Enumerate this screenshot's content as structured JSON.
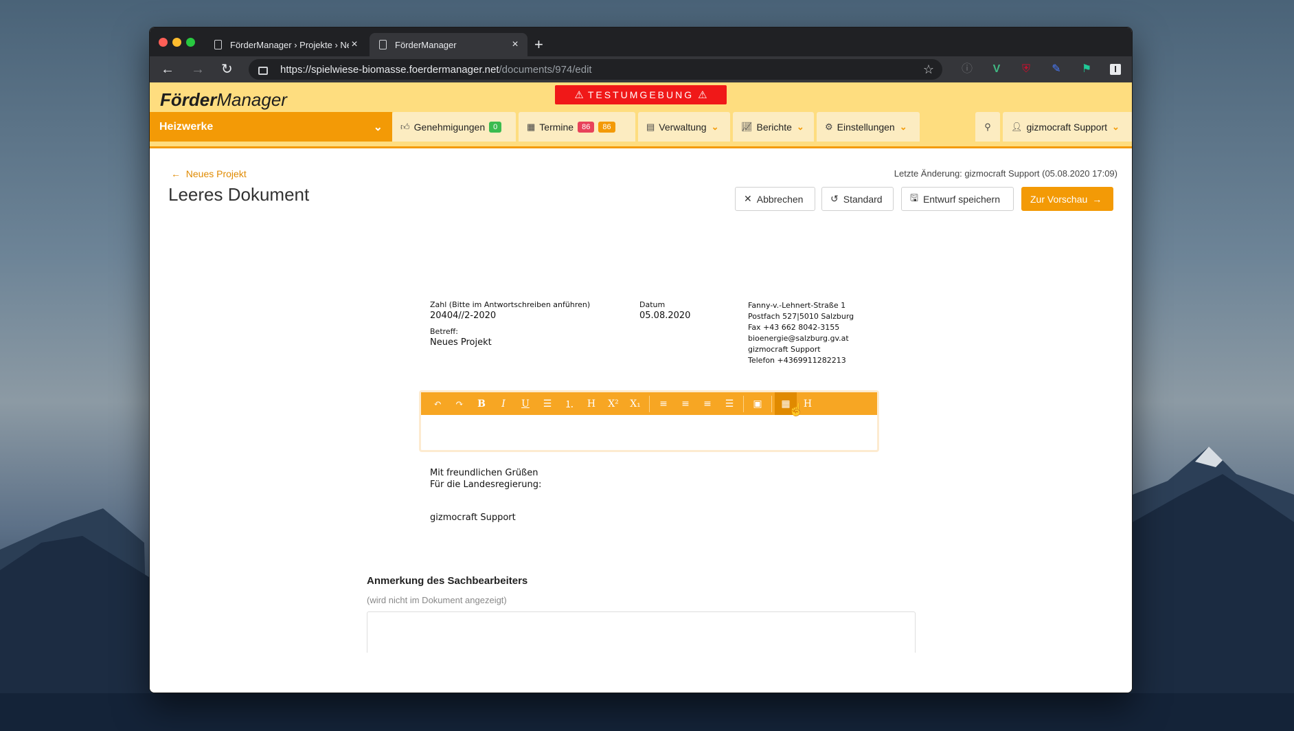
{
  "browser": {
    "tabs": [
      {
        "title": "FörderManager › Projekte › Ne",
        "active": false
      },
      {
        "title": "FörderManager",
        "active": true
      }
    ],
    "url_host": "https://spielwiese-biomasse.foerdermanager.net",
    "url_path": "/documents/974/edit"
  },
  "header": {
    "logo_bold": "Förder",
    "logo_rest": "Manager",
    "test_banner": "TESTUMGEBUNG",
    "site": "Heizwerke",
    "nav": {
      "approvals": {
        "label": "Genehmigungen",
        "badge": "0"
      },
      "appointments": {
        "label": "Termine",
        "badge_red": "86",
        "badge_orange": "86"
      },
      "admin": {
        "label": "Verwaltung"
      },
      "reports": {
        "label": "Berichte"
      },
      "settings": {
        "label": "Einstellungen"
      },
      "user": {
        "label": "gizmocraft Support"
      }
    }
  },
  "page": {
    "back_link": "Neues Projekt",
    "title": "Leeres Dokument",
    "last_change": "Letzte Änderung: gizmocraft Support (05.08.2020 17:09)",
    "buttons": {
      "cancel": "Abbrechen",
      "default": "Standard",
      "save_draft": "Entwurf speichern",
      "preview": "Zur Vorschau"
    }
  },
  "letter": {
    "zahl_label": "Zahl (Bitte im Antwortschreiben anführen)",
    "zahl_value": "20404//2-2020",
    "betreff_label": "Betreff:",
    "betreff_value": "Neues Projekt",
    "datum_label": "Datum",
    "datum_value": "05.08.2020",
    "address": [
      "Fanny-v.-Lehnert-Straße 1",
      "Postfach 527|5010 Salzburg",
      "Fax +43 662 8042-3155",
      "bioenergie@salzburg.gv.at",
      "gizmocraft Support",
      "Telefon +4369911282213"
    ],
    "closing_1": "Mit freundlichen Grüßen",
    "closing_2": "Für die Landesregierung:",
    "signature": "gizmocraft Support"
  },
  "note": {
    "title": "Anmerkung des Sachbearbeiters",
    "hint": "(wird nicht im Dokument angezeigt)"
  },
  "colors": {
    "accent": "#f39a06",
    "header_bg": "#fedd7f",
    "test_banner": "#f01818"
  }
}
